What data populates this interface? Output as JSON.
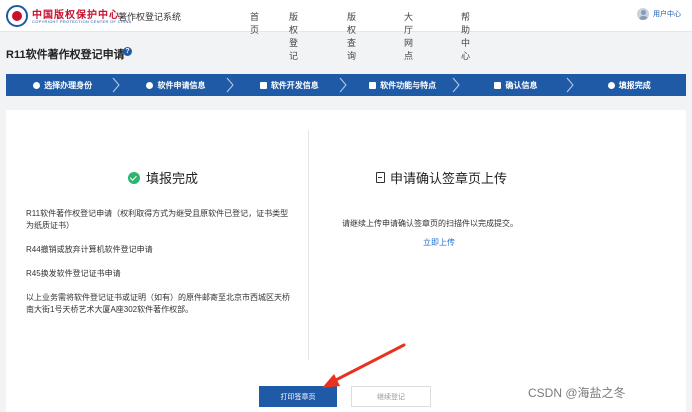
{
  "header": {
    "brand_cn": "中国版权保护中心",
    "brand_en": "COPYRIGHT PROTECTION CENTER OF CHINA",
    "system_name": "著作权登记系统",
    "nav": [
      "首页",
      "版权登记",
      "版权查询",
      "大厅网点",
      "帮助中心"
    ],
    "user_label": "用户中心"
  },
  "page": {
    "title": "R11软件著作权登记申请",
    "help_glyph": "?"
  },
  "steps": [
    {
      "label": "选择办理身份",
      "icon": "person-icon"
    },
    {
      "label": "软件申请信息",
      "icon": "location-icon"
    },
    {
      "label": "软件开发信息",
      "icon": "table-icon"
    },
    {
      "label": "软件功能与特点",
      "icon": "document-icon"
    },
    {
      "label": "确认信息",
      "icon": "document-icon"
    },
    {
      "label": "填报完成",
      "icon": "check-circle-icon"
    }
  ],
  "left_panel": {
    "title": "填报完成",
    "items": [
      "R11软件著作权登记申请（权利取得方式为继受且原软件已登记，证书类型为纸质证书）",
      "R44撤销或放弃计算机软件登记申请",
      "R45换发软件登记证书申请",
      "以上业务需将软件登记证书或证明（如有）的原件邮寄至北京市西城区天桥南大街1号天桥艺术大厦A座302软件著作权部。"
    ]
  },
  "right_panel": {
    "title": "申请确认签章页上传",
    "description": "请继续上传申请确认签章页的扫描件以完成提交。",
    "link": "立即上传"
  },
  "buttons": {
    "print": "打印签章页",
    "next": "继续登记"
  },
  "watermark": "CSDN @海盐之冬",
  "colors": {
    "primary": "#1f5aa6",
    "success": "#2db46e",
    "link": "#1f6fd1",
    "annotation_arrow": "#e8321e"
  }
}
